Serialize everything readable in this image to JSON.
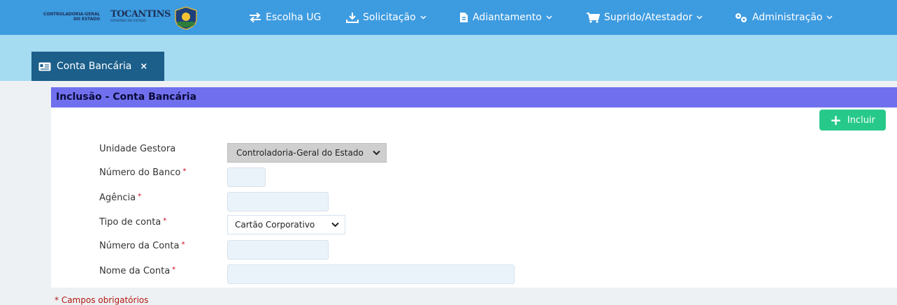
{
  "brand": {
    "cge_line1": "CONTROLADORIA-GERAL",
    "cge_line2": "DO ESTADO",
    "state_name": "TOCANTINS",
    "state_sub": "GOVERNO DO ESTADO"
  },
  "nav": {
    "escolha_ug": "Escolha UG",
    "solicitacao": "Solicitação",
    "adiantamento": "Adiantamento",
    "suprido": "Suprido/Atestador",
    "administracao": "Administração"
  },
  "tab": {
    "label": "Conta Bancária",
    "close": "×"
  },
  "panel": {
    "title": "Inclusão - Conta Bancária"
  },
  "actions": {
    "incluir": "Incluir"
  },
  "form": {
    "unidade_gestora": {
      "label": "Unidade Gestora",
      "value": "Controladoria-Geral do Estado"
    },
    "numero_banco": {
      "label": "Número do Banco",
      "value": ""
    },
    "agencia": {
      "label": "Agência",
      "value": ""
    },
    "tipo_conta": {
      "label": "Tipo de conta",
      "value": "Cartão Corporativo"
    },
    "numero_conta": {
      "label": "Número da Conta",
      "value": ""
    },
    "nome_conta": {
      "label": "Nome da Conta",
      "value": ""
    },
    "required_mark": "*"
  },
  "footer": {
    "required_note": "* Campos obrigatórios"
  },
  "colors": {
    "topbar": "#3d9be0",
    "tabstrip": "#a6dcf2",
    "tab_active": "#1b5f8a",
    "panel_header": "#7070ee",
    "button_green": "#27c98a",
    "required_red": "#d0021b"
  },
  "icons": {
    "exchange": "exchange-icon",
    "download": "download-icon",
    "document": "document-icon",
    "cart": "cart-icon",
    "cogs": "cogs-icon",
    "card": "id-card-icon",
    "plus": "plus-icon"
  }
}
